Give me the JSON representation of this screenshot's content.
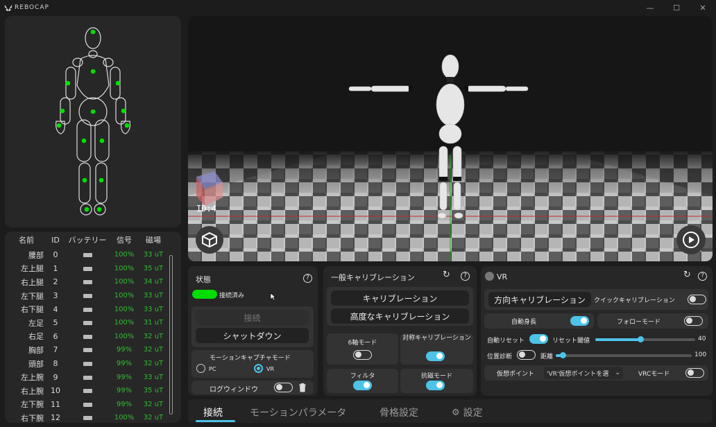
{
  "app": {
    "title": "REBOCAP"
  },
  "window": {
    "minimize": "—",
    "maximize": "☐",
    "close": "✕"
  },
  "sensor_table": {
    "headers": {
      "name": "名前",
      "id": "ID",
      "battery": "バッテリー",
      "signal": "信号",
      "magnetic": "磁場"
    },
    "rows": [
      {
        "name": "腰部",
        "id": "0",
        "signal": "100%",
        "magnetic": "33 uT"
      },
      {
        "name": "左上腿",
        "id": "1",
        "signal": "100%",
        "magnetic": "35 uT"
      },
      {
        "name": "右上腿",
        "id": "2",
        "signal": "100%",
        "magnetic": "34 uT"
      },
      {
        "name": "左下腿",
        "id": "3",
        "signal": "100%",
        "magnetic": "33 uT"
      },
      {
        "name": "右下腿",
        "id": "4",
        "signal": "100%",
        "magnetic": "33 uT"
      },
      {
        "name": "左足",
        "id": "5",
        "signal": "100%",
        "magnetic": "31 uT"
      },
      {
        "name": "右足",
        "id": "6",
        "signal": "100%",
        "magnetic": "32 uT"
      },
      {
        "name": "胸部",
        "id": "7",
        "signal": "99%",
        "magnetic": "32 uT"
      },
      {
        "name": "頭部",
        "id": "8",
        "signal": "99%",
        "magnetic": "32 uT"
      },
      {
        "name": "左上腕",
        "id": "9",
        "signal": "99%",
        "magnetic": "33 uT"
      },
      {
        "name": "右上腕",
        "id": "10",
        "signal": "99%",
        "magnetic": "35 uT"
      },
      {
        "name": "左下腕",
        "id": "11",
        "signal": "99%",
        "magnetic": "32 uT"
      },
      {
        "name": "右下腕",
        "id": "12",
        "signal": "100%",
        "magnetic": "32 uT"
      }
    ]
  },
  "viewport": {
    "id_label": "ID:4"
  },
  "status": {
    "title": "状態",
    "help": "?",
    "connected_label": "接続済み",
    "connect_button": "接続",
    "shutdown_button": "シャットダウン",
    "mode_title": "モーションキャプチャモード",
    "mode_pc": "PC",
    "mode_vr": "VR",
    "mode_selected": "VR",
    "log_window": "ログウィンドウ"
  },
  "calibration": {
    "title": "一般キャリブレーション",
    "help": "?",
    "calibrate_button": "キャリブレーション",
    "advanced_button": "高度なキャリブレーション",
    "six_axis": "6軸モード",
    "symmetric": "対称キャリブレーション",
    "filter": "フィルタ",
    "anti_mag": "抗磁モード",
    "toggles": {
      "six_axis": false,
      "symmetric": true,
      "filter": true,
      "anti_mag": true
    }
  },
  "vr": {
    "title": "VR",
    "help": "?",
    "direction_calib": "方向キャリブレーション",
    "quick_calib": "クイックキャリブレーション",
    "auto_height": "自動身長",
    "follow_mode": "フォローモード",
    "auto_reset": "自動リセット",
    "reset_threshold": "リセット閾値",
    "reset_value": "40",
    "position_diag": "位置診断",
    "distance": "距離",
    "distance_value": "100",
    "virtual_point": "仮想ポイント",
    "virtual_point_select": "'VR'仮想ポイントを選",
    "vrc_mode": "VRCモード",
    "slider_reset_fraction": 0.45,
    "slider_distance_fraction": 0.05
  },
  "tabs": [
    {
      "label": "接続",
      "active": true
    },
    {
      "label": "モーションパラメータ",
      "active": false
    },
    {
      "label": "骨格設定",
      "active": false
    },
    {
      "label": "設定",
      "active": false
    }
  ],
  "colors": {
    "accent": "#4dc3e8",
    "connected": "#00dd00",
    "sensor_dot": "#00e000",
    "good": "#2fbf2f"
  }
}
